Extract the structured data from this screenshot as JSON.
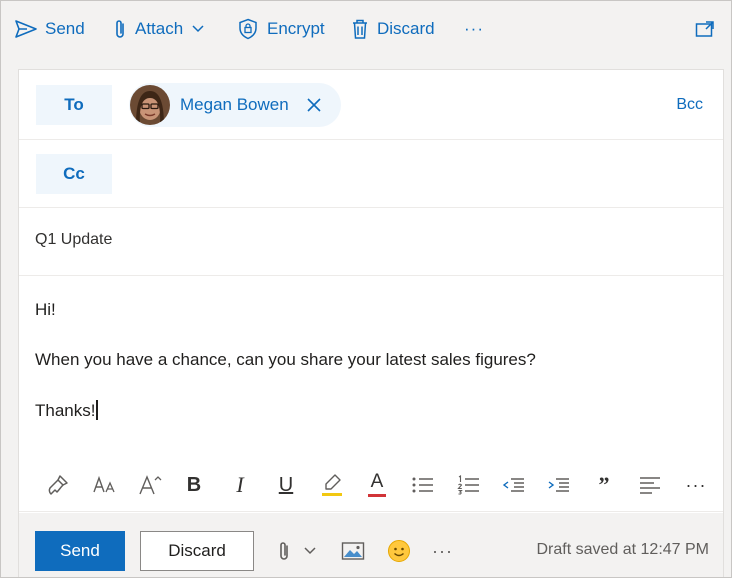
{
  "toolbar": {
    "send_label": "Send",
    "attach_label": "Attach",
    "encrypt_label": "Encrypt",
    "discard_label": "Discard",
    "more_label": "···"
  },
  "recipients": {
    "to_label": "To",
    "cc_label": "Cc",
    "bcc_label": "Bcc",
    "to": [
      {
        "name": "Megan Bowen"
      }
    ]
  },
  "subject": {
    "value": "Q1 Update"
  },
  "message": {
    "lines": [
      "Hi!",
      "When you have a chance, can you share your latest sales figures?",
      "Thanks!"
    ]
  },
  "format_toolbar": {
    "bold_glyph": "B",
    "italic_glyph": "I",
    "underline_glyph": "U",
    "font_color_glyph": "A",
    "quote_glyph": "”",
    "more_glyph": "···"
  },
  "actions": {
    "send_label": "Send",
    "discard_label": "Discard",
    "more_label": "···",
    "draft_status": "Draft saved at 12:47 PM"
  },
  "colors": {
    "accent": "#0f6cbd",
    "pill_background": "#eff6fc",
    "chrome": "#f3f2f1"
  }
}
